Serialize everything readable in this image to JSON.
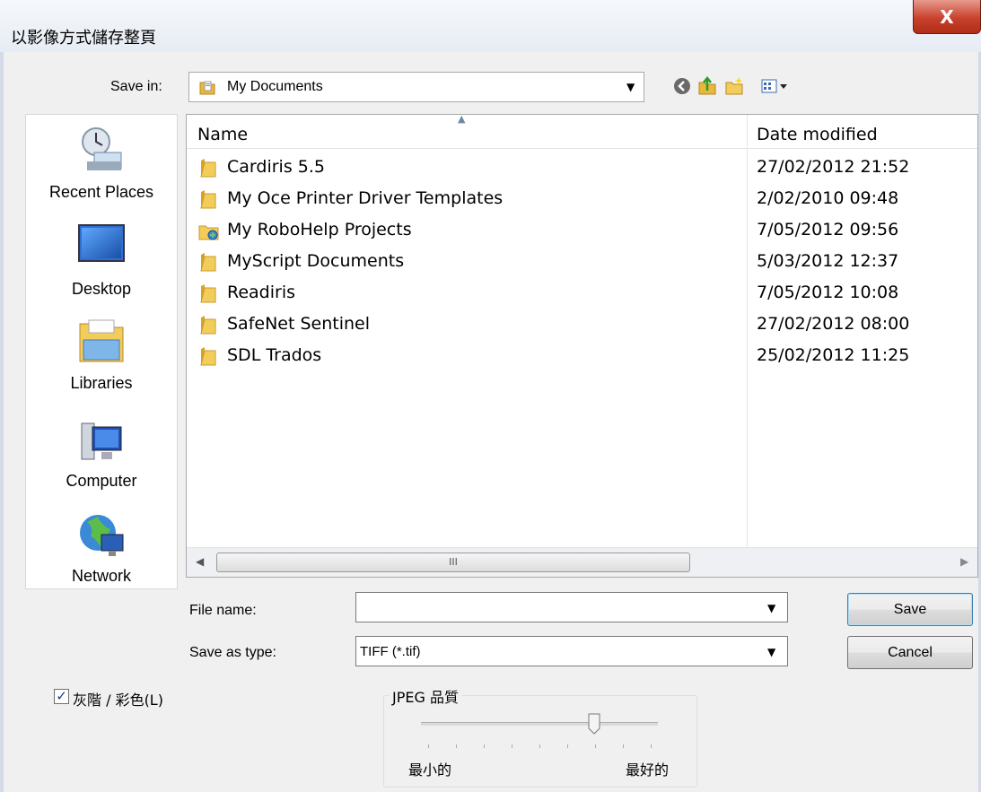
{
  "window": {
    "title": "以影像方式儲存整頁",
    "close_label": "X"
  },
  "save_in": {
    "label": "Save in:",
    "value": "My Documents"
  },
  "toolbar": {
    "icons": [
      "back-icon",
      "up-folder-icon",
      "new-folder-icon",
      "view-menu-icon"
    ]
  },
  "places": [
    {
      "label": "Recent Places",
      "icon": "recent-places-icon"
    },
    {
      "label": "Desktop",
      "icon": "desktop-icon"
    },
    {
      "label": "Libraries",
      "icon": "libraries-icon"
    },
    {
      "label": "Computer",
      "icon": "computer-icon"
    },
    {
      "label": "Network",
      "icon": "network-icon"
    }
  ],
  "file_list": {
    "columns": [
      "Name",
      "Date modified"
    ],
    "rows": [
      {
        "name": "Cardiris 5.5",
        "date": "27/02/2012 21:52",
        "icon": "folder-icon"
      },
      {
        "name": "My Oce Printer Driver Templates",
        "date": "2/02/2010 09:48",
        "icon": "folder-icon"
      },
      {
        "name": "My RoboHelp Projects",
        "date": "7/05/2012 09:56",
        "icon": "special-folder-icon"
      },
      {
        "name": "MyScript Documents",
        "date": "5/03/2012 12:37",
        "icon": "folder-icon"
      },
      {
        "name": "Readiris",
        "date": "7/05/2012 10:08",
        "icon": "folder-icon"
      },
      {
        "name": "SafeNet Sentinel",
        "date": "27/02/2012 08:00",
        "icon": "folder-icon"
      },
      {
        "name": "SDL Trados",
        "date": "25/02/2012 11:25",
        "icon": "folder-icon"
      }
    ],
    "scroll_grip": "III"
  },
  "file_name": {
    "label": "File name:",
    "value": ""
  },
  "save_as_type": {
    "label": "Save as type:",
    "value": "TIFF (*.tif)"
  },
  "buttons": {
    "save": "Save",
    "cancel": "Cancel"
  },
  "grayscale": {
    "label": "灰階 / 彩色(L)",
    "checked": true,
    "mark": "✓"
  },
  "jpeg_quality": {
    "title": "JPEG 品質",
    "min_label": "最小的",
    "max_label": "最好的",
    "level": 0.73
  },
  "colors": {
    "accent": "#3c7fb1",
    "close": "#c9412c",
    "folder": "#e8b83a"
  }
}
